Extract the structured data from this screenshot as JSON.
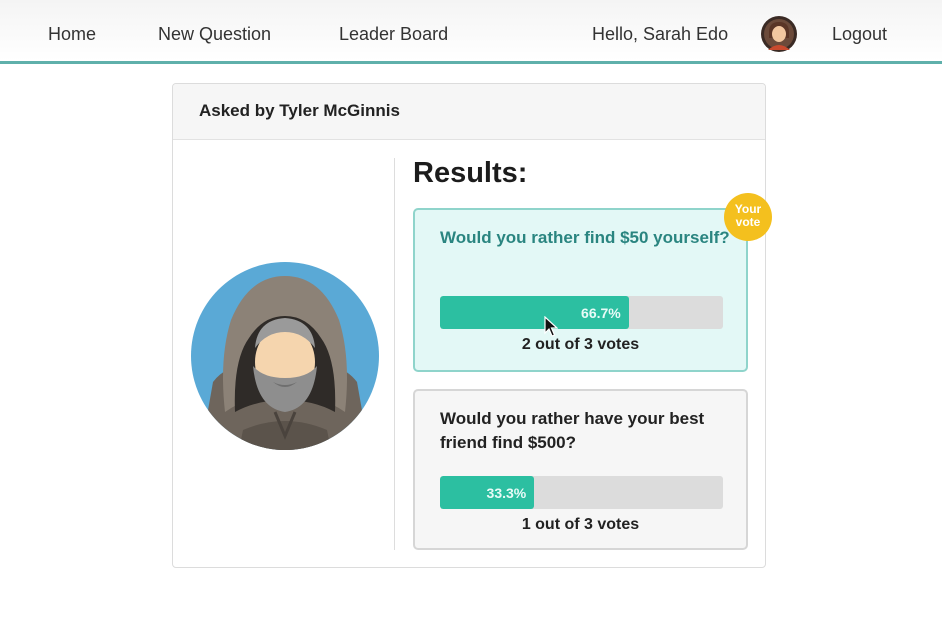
{
  "nav": {
    "home": "Home",
    "new_question": "New Question",
    "leader_board": "Leader Board",
    "greeting": "Hello, Sarah Edo",
    "logout": "Logout",
    "avatar_icon": "user-avatar-icon"
  },
  "question": {
    "asked_by": "Asked by Tyler McGinnis",
    "author_avatar_icon": "hooded-bearded-man-avatar-icon",
    "results_title": "Results:",
    "your_vote_badge": "Your vote",
    "options": [
      {
        "text": "Would you rather find $50 yourself?",
        "percent_label": "66.7%",
        "percent": 66.7,
        "votes_label": "2 out of 3 votes",
        "voted": true
      },
      {
        "text": "Would you rather have your best friend find $500?",
        "percent_label": "33.3%",
        "percent": 33.3,
        "votes_label": "1 out of 3 votes",
        "voted": false
      }
    ]
  },
  "colors": {
    "accent": "#2cbfa1",
    "nav_underline": "#5fb0ab",
    "voted_background": "#e3f8f6",
    "badge": "#f4c01e",
    "avatar_background": "#5aa9d6"
  }
}
